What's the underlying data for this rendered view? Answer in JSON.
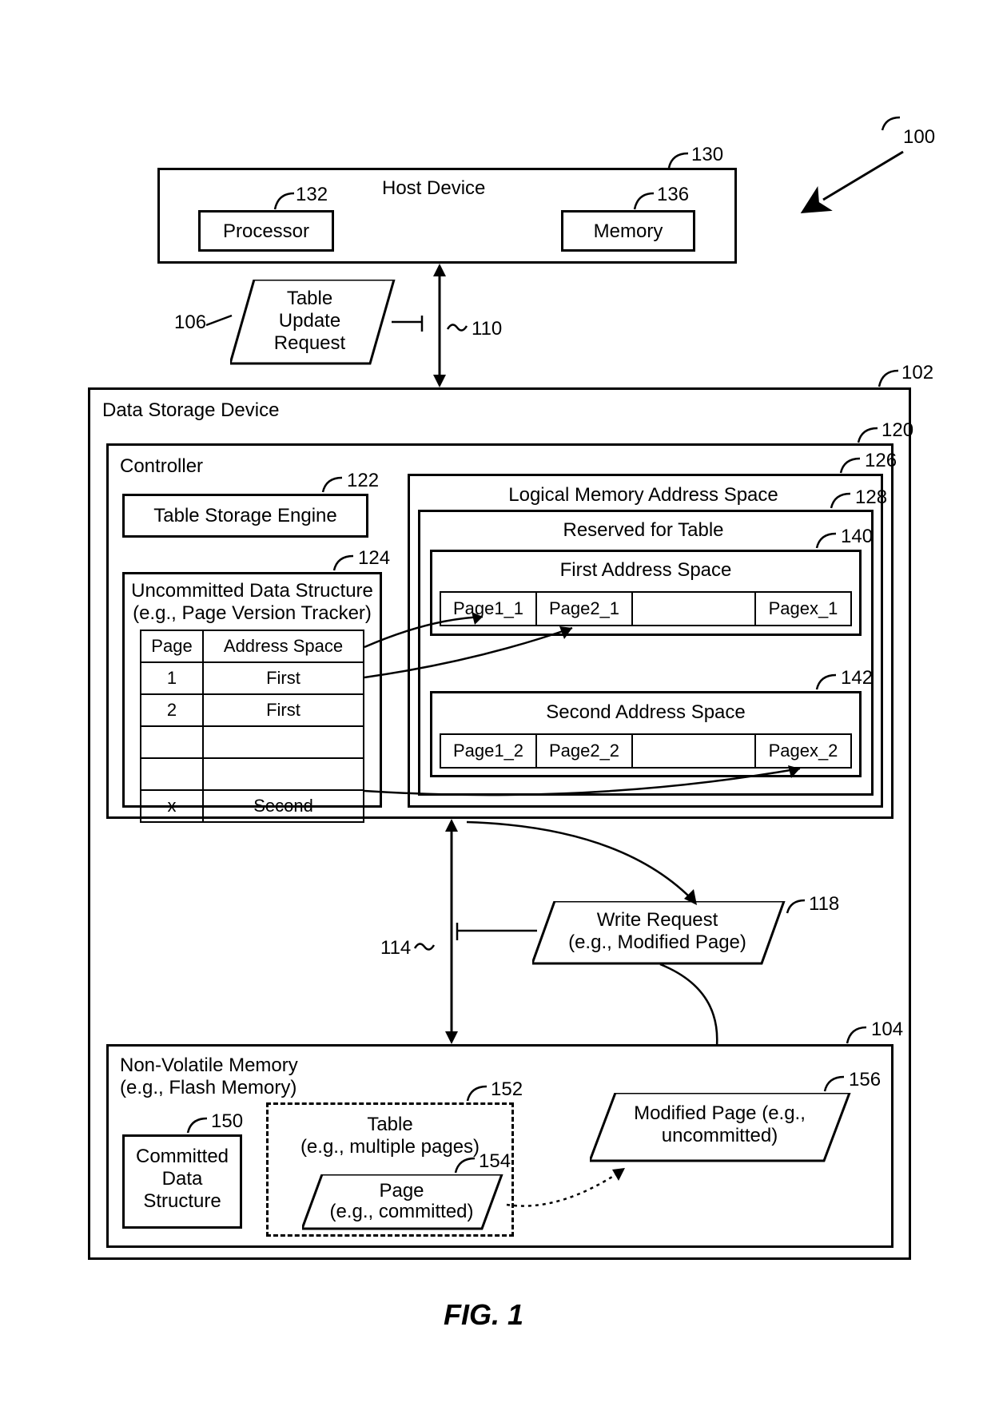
{
  "figure_label": "FIG. 1",
  "refs": {
    "r100": "100",
    "r102": "102",
    "r104": "104",
    "r106": "106",
    "r110": "110",
    "r114": "114",
    "r118": "118",
    "r120": "120",
    "r122": "122",
    "r124": "124",
    "r126": "126",
    "r128": "128",
    "r130": "130",
    "r132": "132",
    "r136": "136",
    "r140": "140",
    "r142": "142",
    "r150": "150",
    "r152": "152",
    "r154": "154",
    "r156": "156"
  },
  "host": {
    "title": "Host Device",
    "processor": "Processor",
    "memory": "Memory"
  },
  "table_update_request": {
    "l1": "Table",
    "l2": "Update",
    "l3": "Request"
  },
  "dsd": {
    "title": "Data Storage Device",
    "controller": {
      "title": "Controller",
      "storage_engine": "Table Storage Engine",
      "uncommitted": {
        "title_l1": "Uncommitted Data Structure",
        "title_l2": "(e.g., Page Version Tracker)",
        "headers": {
          "page": "Page",
          "space": "Address Space"
        },
        "rows": [
          {
            "page": "1",
            "space": "First"
          },
          {
            "page": "2",
            "space": "First"
          },
          {
            "page": "",
            "space": ""
          },
          {
            "page": "",
            "space": ""
          },
          {
            "page": "x",
            "space": "Second"
          }
        ]
      },
      "logical": {
        "title": "Logical Memory Address Space",
        "reserved": "Reserved for Table",
        "first": {
          "title": "First Address Space",
          "cells": [
            "Page1_1",
            "Page2_1",
            "",
            "Pagex_1"
          ]
        },
        "second": {
          "title": "Second Address Space",
          "cells": [
            "Page1_2",
            "Page2_2",
            "",
            "Pagex_2"
          ]
        }
      }
    },
    "write_request": {
      "l1": "Write Request",
      "l2": "(e.g., Modified Page)"
    },
    "nvm": {
      "title_l1": "Non-Volatile Memory",
      "title_l2": "(e.g., Flash Memory)",
      "committed": {
        "l1": "Committed",
        "l2": "Data",
        "l3": "Structure"
      },
      "table": {
        "l1": "Table",
        "l2": "(e.g., multiple pages)"
      },
      "page": {
        "l1": "Page",
        "l2": "(e.g., committed)"
      },
      "modified": {
        "l1": "Modified Page (e.g.,",
        "l2": "uncommitted)"
      }
    }
  }
}
